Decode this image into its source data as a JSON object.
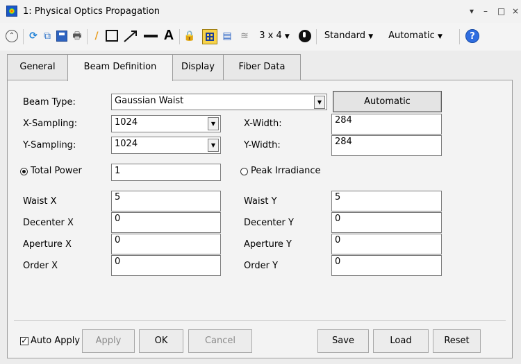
{
  "window": {
    "title": "1: Physical Optics Propagation",
    "controls": {
      "dropdown": "▾",
      "minimize": "–",
      "maximize": "□",
      "close": "×"
    }
  },
  "toolbar": {
    "layout_label": "3 x 4",
    "standard_label": "Standard",
    "automatic_label": "Automatic",
    "help_label": "?"
  },
  "tabs": [
    {
      "label": "General",
      "active": false
    },
    {
      "label": "Beam Definition",
      "active": true
    },
    {
      "label": "Display",
      "active": false
    },
    {
      "label": "Fiber Data",
      "active": false
    }
  ],
  "form": {
    "beam_type_label": "Beam Type:",
    "beam_type_value": "Gaussian Waist",
    "automatic_button": "Automatic",
    "x_sampling_label": "X-Sampling:",
    "x_sampling_value": "1024",
    "y_sampling_label": "Y-Sampling:",
    "y_sampling_value": "1024",
    "x_width_label": "X-Width:",
    "x_width_value": "284",
    "y_width_label": "Y-Width:",
    "y_width_value": "284",
    "total_power_label": "Total Power",
    "total_power_value": "1",
    "peak_irradiance_label": "Peak Irradiance",
    "waist_x_label": "Waist X",
    "waist_x_value": "5",
    "waist_y_label": "Waist Y",
    "waist_y_value": "5",
    "decenter_x_label": "Decenter X",
    "decenter_x_value": "0",
    "decenter_y_label": "Decenter Y",
    "decenter_y_value": "0",
    "aperture_x_label": "Aperture X",
    "aperture_x_value": "0",
    "aperture_y_label": "Aperture Y",
    "aperture_y_value": "0",
    "order_x_label": "Order X",
    "order_x_value": "0",
    "order_y_label": "Order Y",
    "order_y_value": "0"
  },
  "footer": {
    "auto_apply_label": "Auto Apply",
    "auto_apply_checked": true,
    "apply_label": "Apply",
    "ok_label": "OK",
    "cancel_label": "Cancel",
    "save_label": "Save",
    "load_label": "Load",
    "reset_label": "Reset"
  },
  "colors": {
    "accent": "#2f6de0",
    "panel_bg": "#f3f3f3",
    "border": "#9a9a9a"
  }
}
